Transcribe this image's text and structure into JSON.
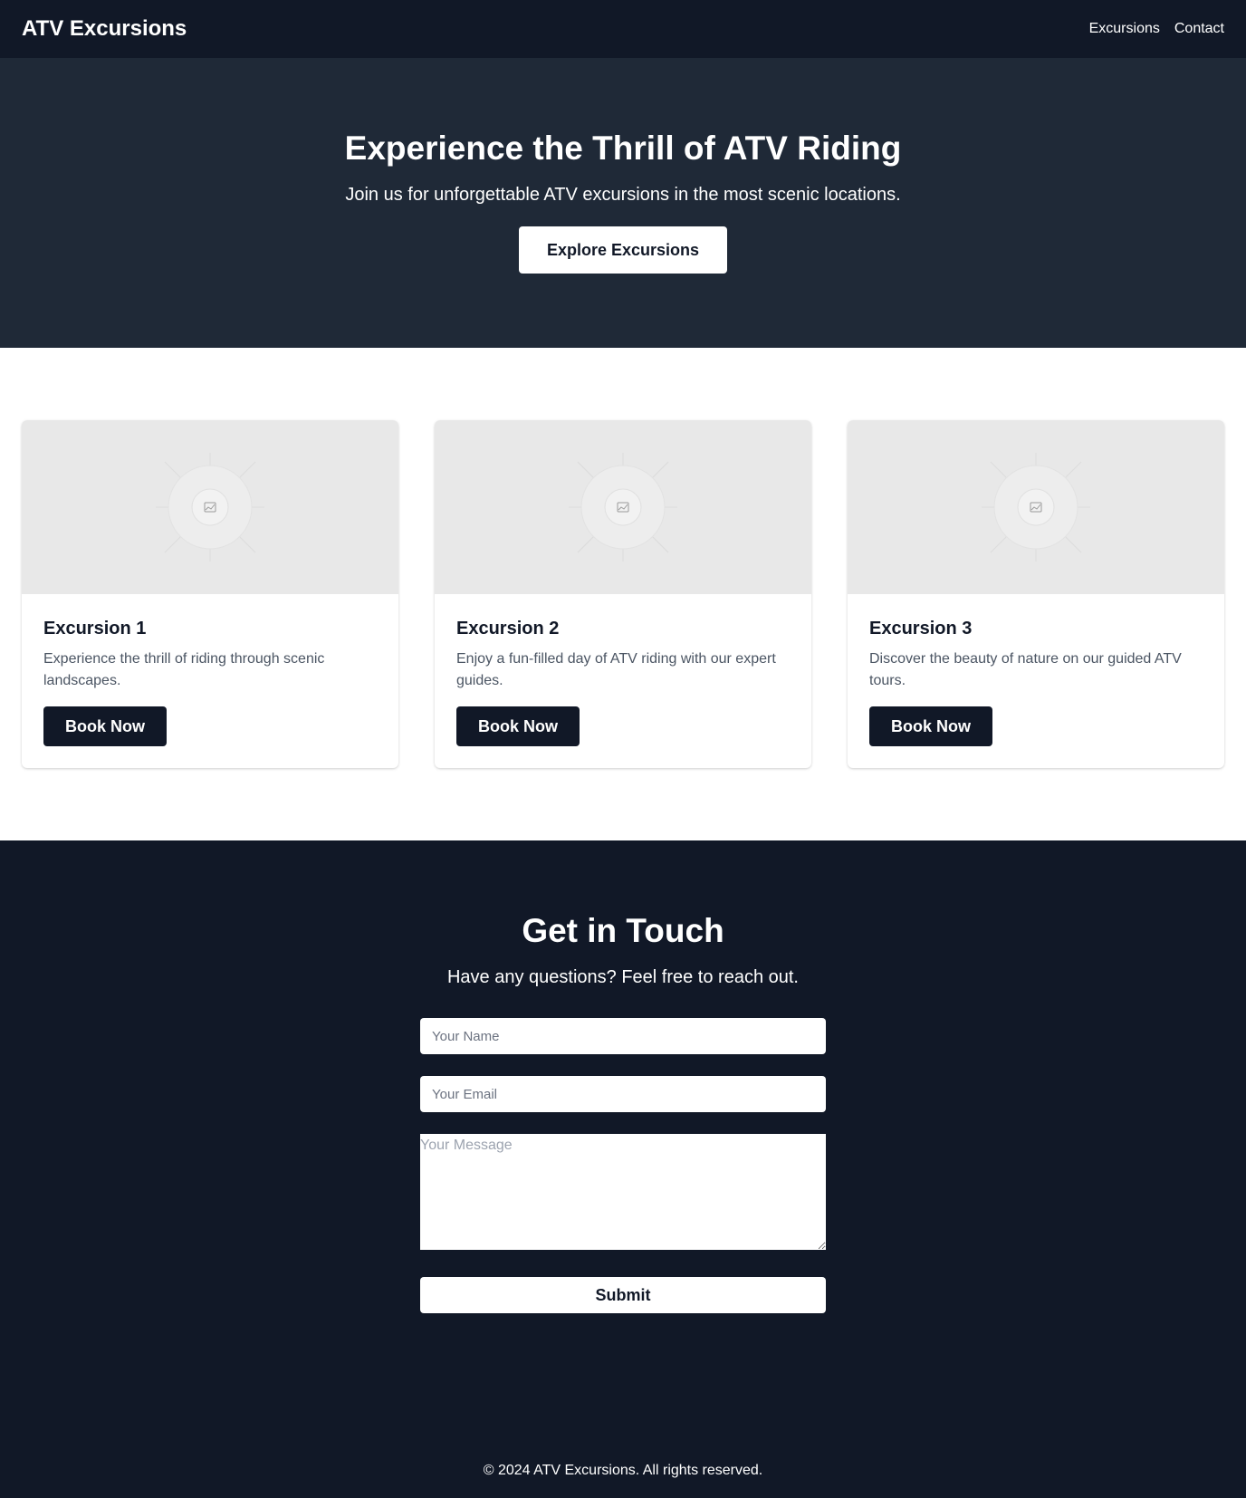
{
  "header": {
    "logo": "ATV Excursions",
    "nav": [
      {
        "label": "Excursions"
      },
      {
        "label": "Contact"
      }
    ]
  },
  "hero": {
    "title": "Experience the Thrill of ATV Riding",
    "subtitle": "Join us for unforgettable ATV excursions in the most scenic locations.",
    "button_label": "Explore Excursions"
  },
  "excursions": [
    {
      "title": "Excursion 1",
      "description": "Experience the thrill of riding through scenic landscapes.",
      "button_label": "Book Now",
      "image_icon": "image-placeholder-icon"
    },
    {
      "title": "Excursion 2",
      "description": "Enjoy a fun-filled day of ATV riding with our expert guides.",
      "button_label": "Book Now",
      "image_icon": "image-placeholder-icon"
    },
    {
      "title": "Excursion 3",
      "description": "Discover the beauty of nature on our guided ATV tours.",
      "button_label": "Book Now",
      "image_icon": "image-placeholder-icon"
    }
  ],
  "contact": {
    "title": "Get in Touch",
    "subtitle": "Have any questions? Feel free to reach out.",
    "name_placeholder": "Your Name",
    "email_placeholder": "Your Email",
    "message_placeholder": "Your Message",
    "submit_label": "Submit"
  },
  "footer": {
    "text": "© 2024 ATV Excursions. All rights reserved."
  },
  "colors": {
    "header_bg": "#111827",
    "hero_bg": "#1f2937",
    "contact_bg": "#111827",
    "accent_button": "#111827",
    "card_image_bg": "#e8e8e8"
  }
}
